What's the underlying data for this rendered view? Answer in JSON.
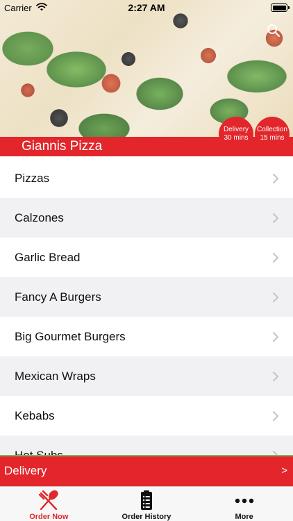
{
  "status_bar": {
    "carrier": "Carrier",
    "time": "2:27 AM"
  },
  "header": {
    "store_name": "Giannis Pizza",
    "delivery_badge": {
      "line1": "Delivery",
      "line2": "30 mins"
    },
    "collection_badge": {
      "line1": "Collection",
      "line2": "15 mins"
    },
    "search_icon": "search-icon"
  },
  "menu": {
    "categories": [
      "Pizzas",
      "Calzones",
      "Garlic Bread",
      "Fancy A Burgers",
      "Big Gourmet Burgers",
      "Mexican Wraps",
      "Kebabs",
      "Hot Subs"
    ]
  },
  "order_bar": {
    "label": "Delivery",
    "arrow": ">"
  },
  "tabs": [
    {
      "label": "Order Now",
      "icon": "fork-knife-icon",
      "active": true
    },
    {
      "label": "Order History",
      "icon": "clipboard-list-icon",
      "active": false
    },
    {
      "label": "More",
      "icon": "more-dots-icon",
      "active": false
    }
  ],
  "colors": {
    "accent": "#e2262b",
    "row_alt": "#f1f1f3",
    "tab_bg": "#f7f7f7"
  }
}
